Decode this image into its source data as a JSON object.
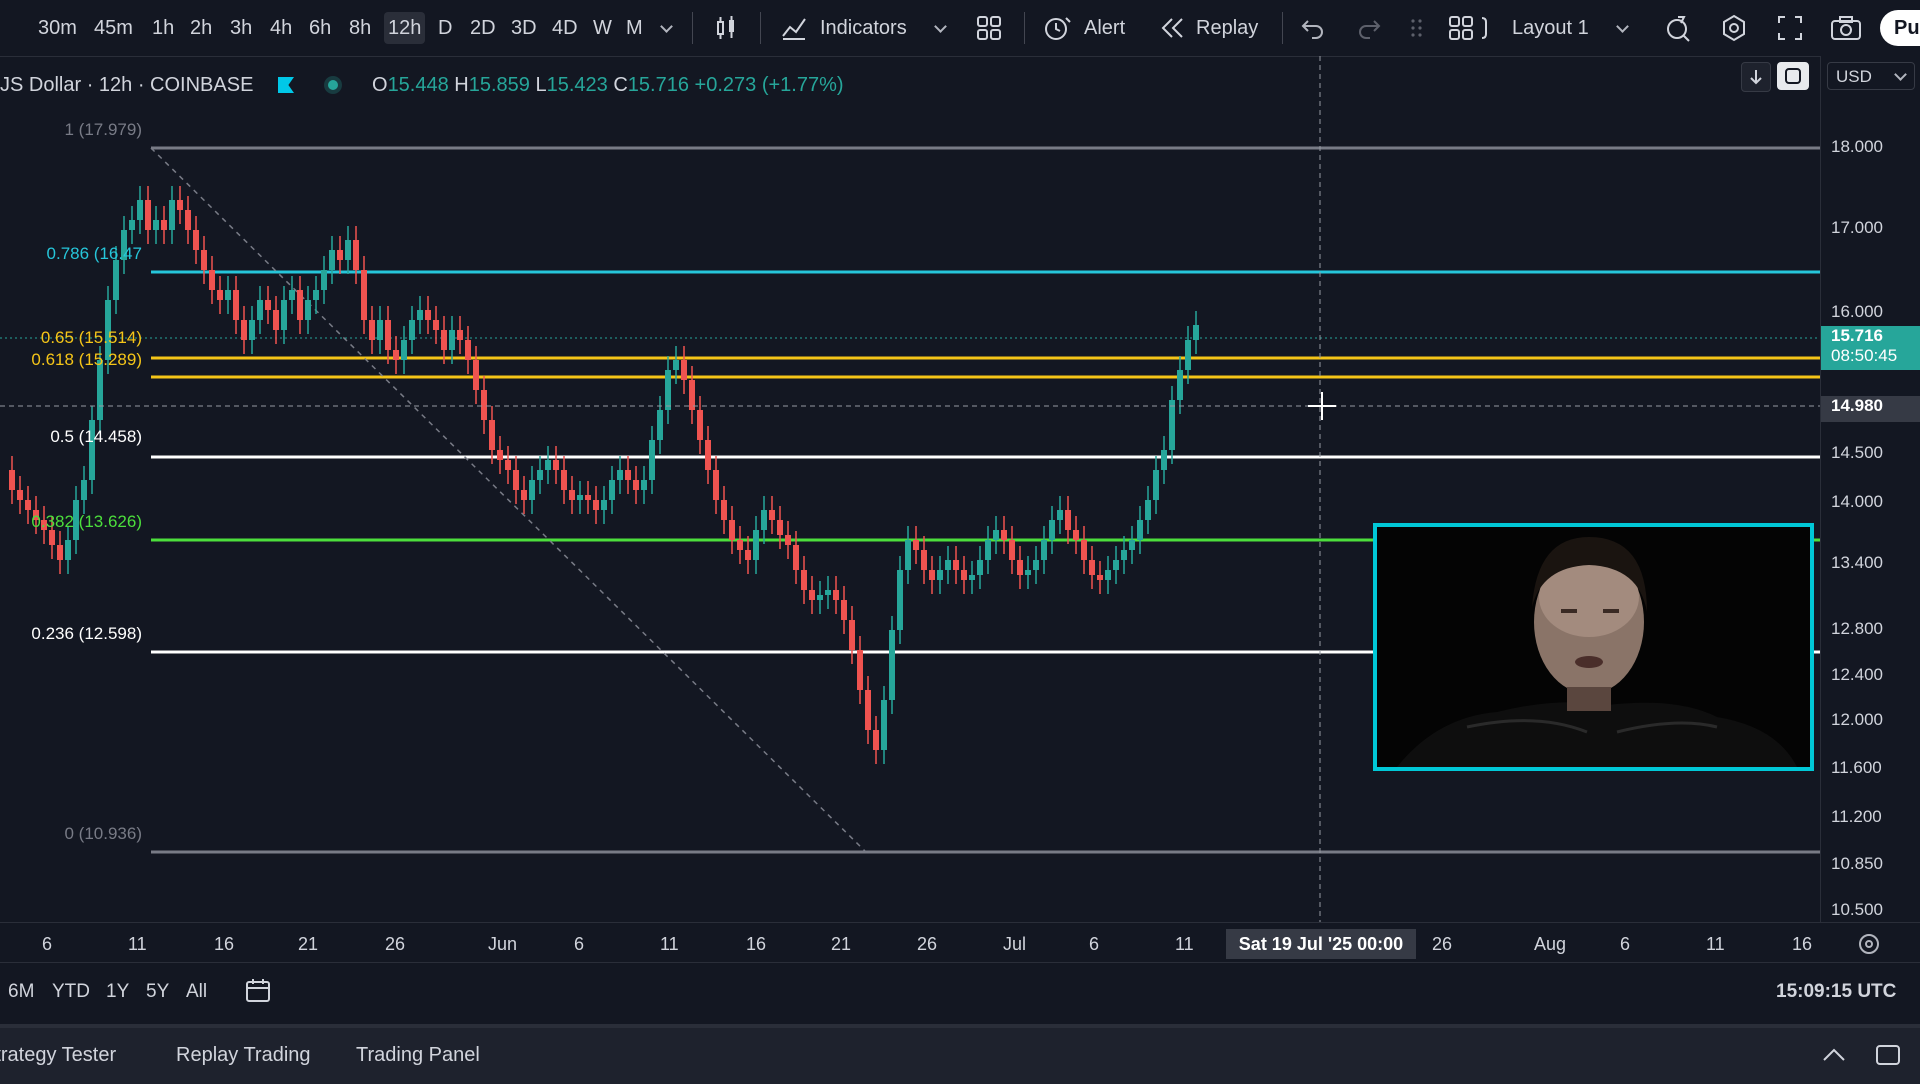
{
  "toolbar": {
    "intervals": [
      "30m",
      "45m",
      "1h",
      "2h",
      "3h",
      "4h",
      "6h",
      "8h",
      "12h",
      "D",
      "2D",
      "3D",
      "4D",
      "W",
      "M"
    ],
    "active_interval": "12h",
    "indicators_label": "Indicators",
    "alert_label": "Alert",
    "replay_label": "Replay",
    "layout_label": "Layout 1",
    "publish_label": "Pu"
  },
  "legend": {
    "symbol": "JS Dollar · 12h · COINBASE",
    "open_label": "O",
    "open": "15.448",
    "high_label": "H",
    "high": "15.859",
    "low_label": "L",
    "low": "15.423",
    "close_label": "C",
    "close": "15.716",
    "change": "+0.273 (+1.77%)"
  },
  "currency": "USD",
  "fib_labels": {
    "f1": "1 (17.979)",
    "f786": "0.786 (16.47",
    "f65": "0.65 (15.514)",
    "f618": "0.618 (15.289)",
    "f5": "0.5 (14.458)",
    "f382": "0.382 (13.626)",
    "f236": "0.236 (12.598)",
    "f0": "0 (10.936)"
  },
  "price_scale": [
    "18.000",
    "17.000",
    "16.000",
    "14.500",
    "14.000",
    "13.400",
    "12.800",
    "12.400",
    "12.000",
    "11.600",
    "11.200",
    "10.850",
    "10.500"
  ],
  "last_price": {
    "value": "15.716",
    "countdown": "08:50:45"
  },
  "crosshair_price": "14.980",
  "time_axis": [
    "6",
    "11",
    "16",
    "21",
    "26",
    "Jun",
    "6",
    "11",
    "16",
    "21",
    "26",
    "Jul",
    "6",
    "11",
    "26",
    "Aug",
    "6",
    "11",
    "16"
  ],
  "crosshair_time": "Sat 19 Jul '25   00:00",
  "range_buttons": [
    "6M",
    "YTD",
    "1Y",
    "5Y",
    "All"
  ],
  "clock": "15:09:15 UTC",
  "bottom_tabs": [
    "Strategy Tester",
    "Replay Trading",
    "Trading Panel"
  ],
  "colors": {
    "up": "#26a69a",
    "down": "#ef5350",
    "accent_cyan": "#00c8d7",
    "fib_yellow": "#f5c518",
    "fib_green": "#4cdf3c"
  }
}
